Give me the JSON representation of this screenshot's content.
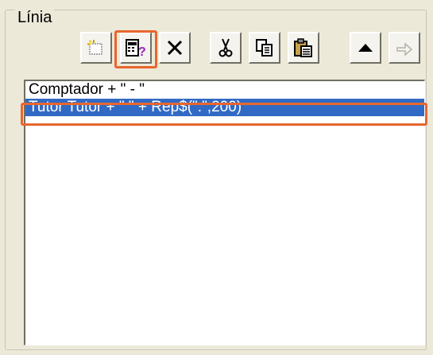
{
  "group": {
    "title": "Línia"
  },
  "toolbar": {
    "buttons": [
      {
        "icon": "new-item-icon",
        "enabled": true
      },
      {
        "icon": "field-query-icon",
        "enabled": true,
        "highlighted": true
      },
      {
        "icon": "delete-icon",
        "enabled": true
      },
      {
        "icon": "cut-icon",
        "enabled": true
      },
      {
        "icon": "copy-icon",
        "enabled": true
      },
      {
        "icon": "paste-icon",
        "enabled": true
      },
      {
        "icon": "move-up-icon",
        "enabled": true
      },
      {
        "icon": "move-down-icon",
        "enabled": false
      }
    ]
  },
  "list": {
    "items": [
      {
        "text": "Comptador + \" - \"",
        "selected": false
      },
      {
        "text": "Tutor  Tutor + \" \" + Rep$(\".\",200)",
        "selected": true
      },
      {
        "text": "---",
        "selected": false
      }
    ]
  },
  "colors": {
    "highlight": "#e8662e",
    "selection": "#316ac5",
    "window_bg": "#ece9d8"
  }
}
